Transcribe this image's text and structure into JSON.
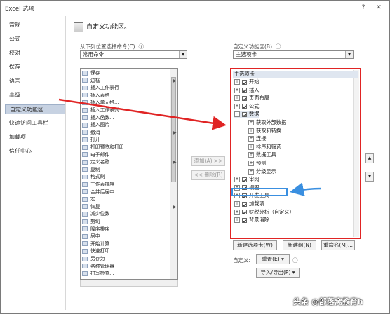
{
  "window": {
    "title": "Excel 选项",
    "help": "?",
    "close": "✕"
  },
  "nav": {
    "items": [
      {
        "label": "常规"
      },
      {
        "label": "公式"
      },
      {
        "label": "校对"
      },
      {
        "label": "保存"
      },
      {
        "label": "语言"
      },
      {
        "label": "高级"
      },
      {
        "label": "自定义功能区"
      },
      {
        "label": "快速访问工具栏"
      },
      {
        "label": "加载项"
      },
      {
        "label": "信任中心"
      }
    ],
    "selected_index": 6
  },
  "main": {
    "heading": "自定义功能区。",
    "left_label": "从下列位置选择命令(C):",
    "left_combo": "常用命令",
    "right_label": "自定义功能区(B):",
    "right_combo": "主选项卡",
    "info_icon": "ⓘ"
  },
  "left_commands": [
    {
      "label": "保存",
      "sub": ""
    },
    {
      "label": "边框",
      "sub": "▶"
    },
    {
      "label": "插入工作表行",
      "sub": ""
    },
    {
      "label": "插入表格",
      "sub": ""
    },
    {
      "label": "插入单元格...",
      "sub": ""
    },
    {
      "label": "插入工作表列",
      "sub": ""
    },
    {
      "label": "插入函数...",
      "sub": ""
    },
    {
      "label": "插入图片",
      "sub": ""
    },
    {
      "label": "撤消",
      "sub": "▶"
    },
    {
      "label": "打开",
      "sub": ""
    },
    {
      "label": "打印预览和打印",
      "sub": ""
    },
    {
      "label": "电子邮件",
      "sub": ""
    },
    {
      "label": "定义名称",
      "sub": "▶"
    },
    {
      "label": "复制",
      "sub": ""
    },
    {
      "label": "格式刷",
      "sub": ""
    },
    {
      "label": "工作表排序",
      "sub": ""
    },
    {
      "label": "合并后居中",
      "sub": ""
    },
    {
      "label": "宏",
      "sub": ""
    },
    {
      "label": "恢复",
      "sub": "▶"
    },
    {
      "label": "减少位数",
      "sub": ""
    },
    {
      "label": "剪切",
      "sub": ""
    },
    {
      "label": "降序排序",
      "sub": ""
    },
    {
      "label": "居中",
      "sub": ""
    },
    {
      "label": "开始计算",
      "sub": ""
    },
    {
      "label": "快速打印",
      "sub": ""
    },
    {
      "label": "另存为",
      "sub": ""
    },
    {
      "label": "名称管理器",
      "sub": ""
    },
    {
      "label": "拼写检查...",
      "sub": ""
    }
  ],
  "buttons": {
    "add": "添加(A) >>",
    "remove": "<< 删除(R)",
    "new_tab": "新建选项卡(W)",
    "new_group": "新建组(N)",
    "rename": "重命名(M)...",
    "customize_label": "自定义:",
    "reset": "重置(E) ▾",
    "import_export": "导入/导出(P) ▾",
    "up": "▲",
    "down": "▼"
  },
  "right_tree": {
    "header": "主选项卡",
    "items": [
      {
        "label": "开始",
        "level": 0,
        "expand": "⊞",
        "checked": true
      },
      {
        "label": "插入",
        "level": 0,
        "expand": "⊞",
        "checked": true
      },
      {
        "label": "页面布局",
        "level": 0,
        "expand": "⊞",
        "checked": true
      },
      {
        "label": "公式",
        "level": 0,
        "expand": "⊞",
        "checked": true
      },
      {
        "label": "数据",
        "level": 0,
        "expand": "⊟",
        "checked": true
      },
      {
        "label": "获取外部数据",
        "level": 1,
        "expand": "⊞",
        "checked": false
      },
      {
        "label": "获取和转换",
        "level": 1,
        "expand": "⊞",
        "checked": false
      },
      {
        "label": "连接",
        "level": 1,
        "expand": "⊞",
        "checked": false
      },
      {
        "label": "排序和筛选",
        "level": 1,
        "expand": "⊞",
        "checked": false
      },
      {
        "label": "数据工具",
        "level": 1,
        "expand": "⊞",
        "checked": false
      },
      {
        "label": "预测",
        "level": 1,
        "expand": "⊞",
        "checked": false
      },
      {
        "label": "分级显示",
        "level": 1,
        "expand": "⊞",
        "checked": false
      },
      {
        "label": "审阅",
        "level": 0,
        "expand": "⊞",
        "checked": true
      },
      {
        "label": "视图",
        "level": 0,
        "expand": "⊞",
        "checked": true
      },
      {
        "label": "开发工具",
        "level": 0,
        "expand": "⊞",
        "checked": true
      },
      {
        "label": "加载项",
        "level": 0,
        "expand": "⊞",
        "checked": true
      },
      {
        "label": "财税分析（自定义）",
        "level": 0,
        "expand": "⊞",
        "checked": true
      },
      {
        "label": "背景消除",
        "level": 0,
        "expand": "⊞",
        "checked": true
      }
    ]
  },
  "watermark": "头条 @部落窝教育h",
  "colors": {
    "highlight_red": "#e02424",
    "highlight_blue": "#3a8fe0",
    "nav_selected": "#c7d2e2"
  }
}
